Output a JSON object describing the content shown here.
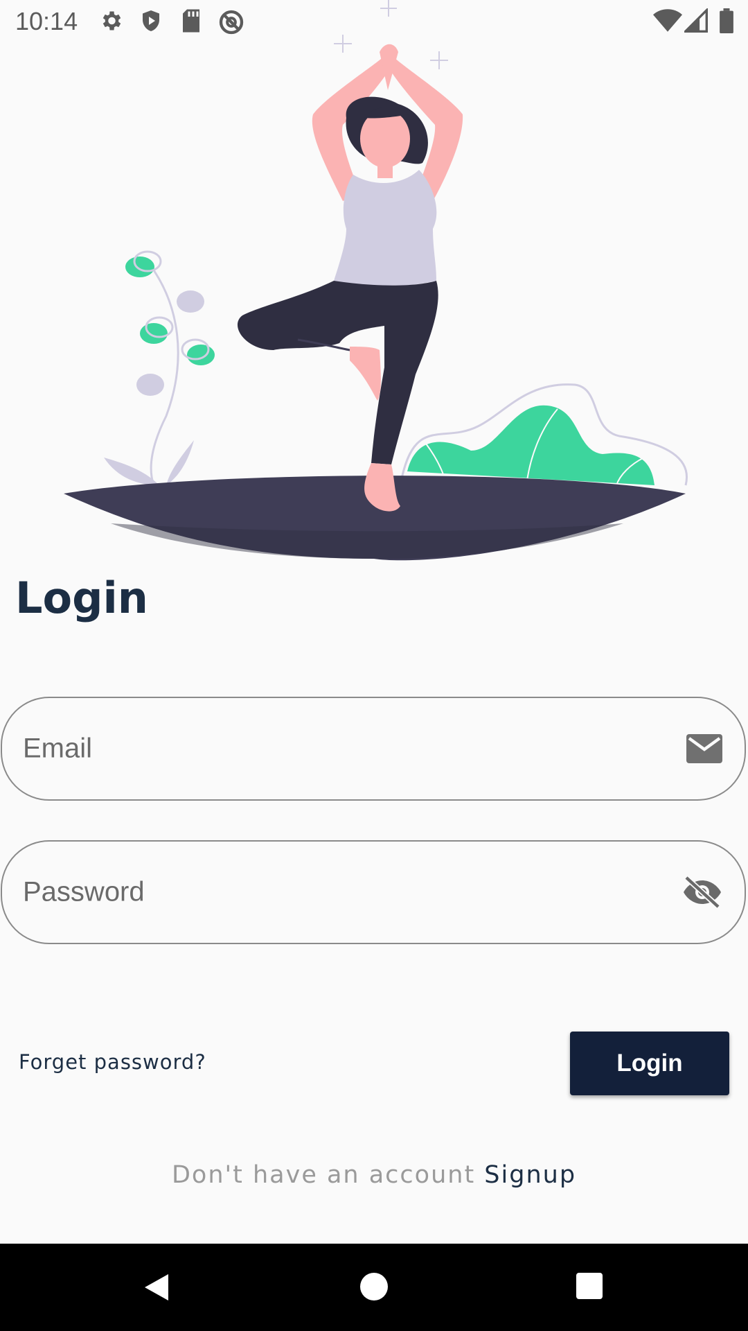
{
  "status_bar": {
    "time": "10:14",
    "icons": [
      "gear-icon",
      "shield-play-icon",
      "sd-card-icon",
      "no-sync-icon",
      "wifi-icon",
      "cell-signal-icon",
      "battery-icon"
    ]
  },
  "illustration": {
    "description_icon": "yoga-woman-illustration",
    "colors": {
      "skin": "#fbb3b3",
      "hair": "#2f2e41",
      "top": "#d0cde1",
      "pants": "#2f2e41",
      "ground": "#3f3d56",
      "plant_green": "#3dd59d"
    }
  },
  "login": {
    "title": "Login",
    "email_placeholder": "Email",
    "password_placeholder": "Password",
    "forget_password": "Forget password?",
    "login_button": "Login",
    "signup_prompt": "Don't have an account ",
    "signup_link": "Signup"
  },
  "nav_bar": {
    "icons": [
      "back-icon",
      "home-icon",
      "recents-icon"
    ]
  },
  "colors": {
    "primary": "#13203a",
    "title": "#1c2e44",
    "background": "#fafafa"
  }
}
